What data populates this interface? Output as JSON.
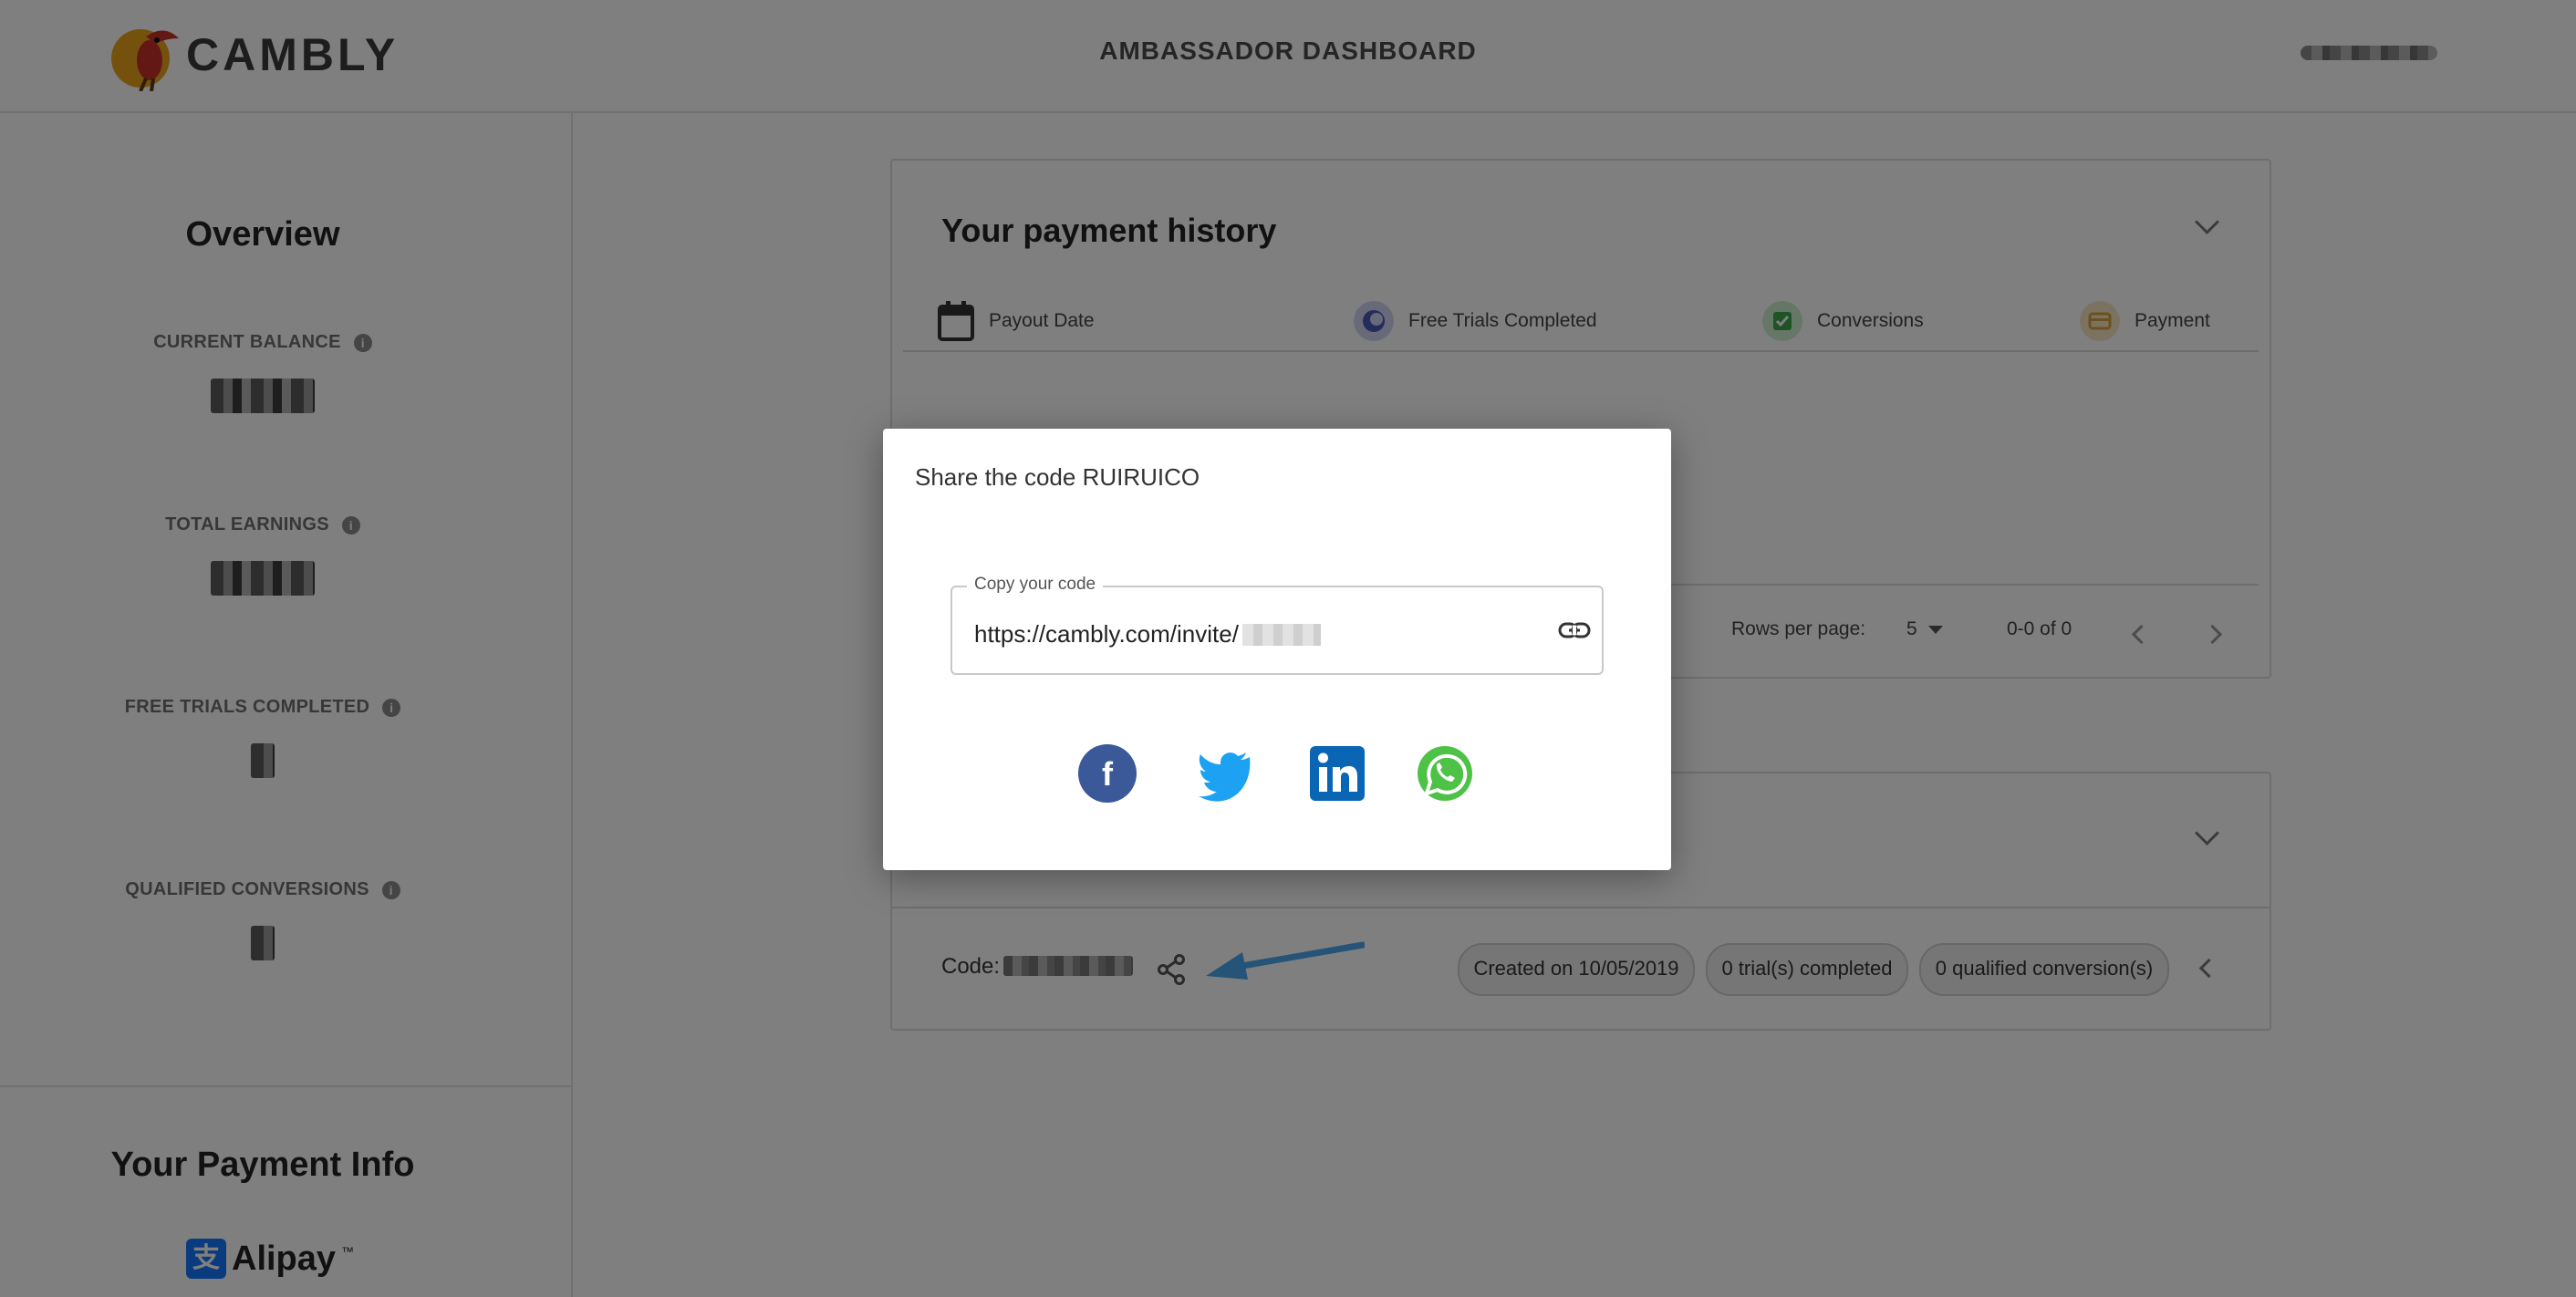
{
  "header": {
    "brand": "CAMBLY",
    "title": "AMBASSADOR DASHBOARD"
  },
  "sidebar": {
    "overview_title": "Overview",
    "stats": [
      {
        "label": "CURRENT BALANCE"
      },
      {
        "label": "TOTAL EARNINGS"
      },
      {
        "label": "FREE TRIALS COMPLETED"
      },
      {
        "label": "QUALIFIED CONVERSIONS"
      }
    ],
    "payment_info_title": "Your Payment Info",
    "payment_method": "Alipay",
    "payment_method_tm": "™"
  },
  "history": {
    "title": "Your payment history",
    "columns": [
      "Payout Date",
      "Free Trials Completed",
      "Conversions",
      "Payment"
    ],
    "rows_per_page_label": "Rows per page:",
    "rows_per_page_value": "5",
    "range": "0-0 of 0"
  },
  "codes": {
    "code_label": "Code:",
    "chips": [
      "Created on 10/05/2019",
      "0 trial(s) completed",
      "0 qualified conversion(s)"
    ]
  },
  "modal": {
    "title": "Share the code RUIRUICO",
    "field_label": "Copy your code",
    "field_value": "https://cambly.com/invite/"
  },
  "colors": {
    "facebook": "#3b5998",
    "twitter": "#1da1f2",
    "linkedin": "#0077b5",
    "whatsapp": "#4dc247",
    "arrow": "#4aa8f0"
  },
  "icons": [
    "info-icon",
    "calendar-icon",
    "trials-icon",
    "conversions-icon",
    "payment-icon",
    "chevron-down-icon",
    "chevron-left-icon",
    "chevron-right-icon",
    "share-icon",
    "link-icon",
    "facebook-icon",
    "twitter-icon",
    "linkedin-icon",
    "whatsapp-icon"
  ]
}
